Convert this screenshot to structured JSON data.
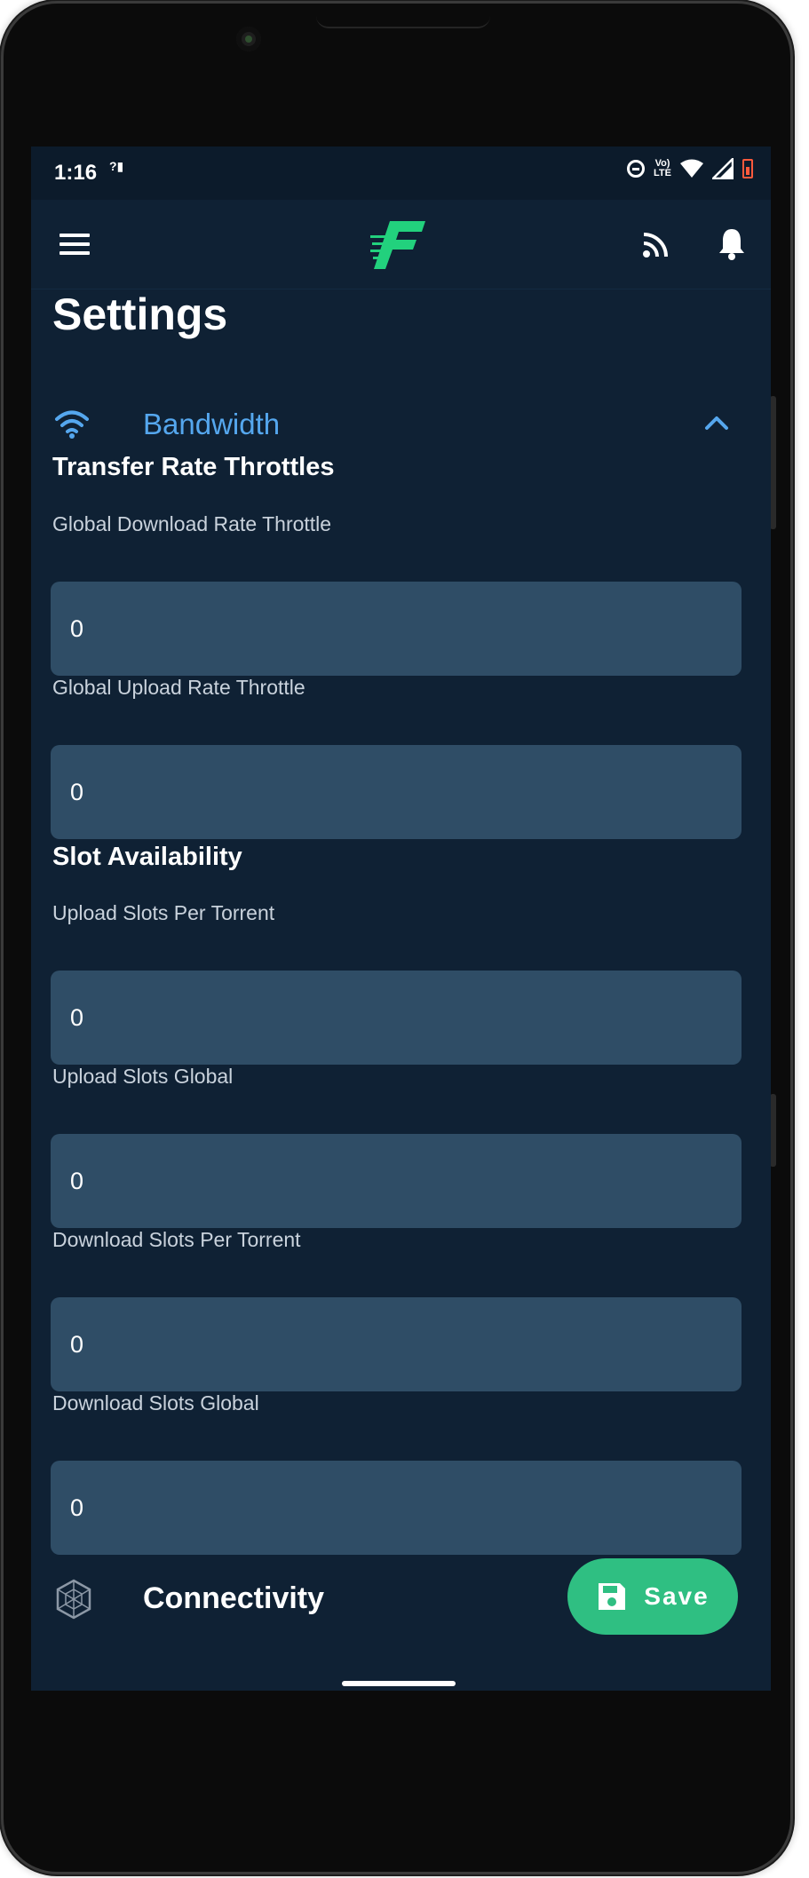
{
  "statusbar": {
    "time": "1:16",
    "network_icon": "no-signal-icon",
    "volte_top": "Vo)",
    "volte_bottom": "LTE",
    "icons": [
      "do-not-disturb-icon",
      "volte-icon",
      "wifi-icon",
      "signal-icon",
      "battery-low-icon"
    ],
    "battery_color": "#ff5a3c"
  },
  "appbar": {
    "menu_icon": "hamburger-menu-icon",
    "logo_icon": "app-logo-f-icon",
    "logo_color": "#22d17d",
    "cast_icon": "rss-feed-icon",
    "notification_icon": "bell-icon"
  },
  "page": {
    "title": "Settings"
  },
  "bandwidth": {
    "icon": "wifi-icon",
    "label": "Bandwidth",
    "expanded": true,
    "accent_color": "#55a7ee",
    "groups": [
      {
        "title": "Transfer Rate Throttles",
        "fields": [
          {
            "label": "Global Download Rate Throttle",
            "value": "0"
          },
          {
            "label": "Global Upload Rate Throttle",
            "value": "0"
          }
        ]
      },
      {
        "title": "Slot Availability",
        "fields": [
          {
            "label": "Upload Slots Per Torrent",
            "value": "0"
          },
          {
            "label": "Upload Slots Global",
            "value": "0"
          },
          {
            "label": "Download Slots Per Torrent",
            "value": "0"
          },
          {
            "label": "Download Slots Global",
            "value": "0"
          }
        ]
      }
    ]
  },
  "connectivity": {
    "icon": "hexagon-network-icon",
    "label": "Connectivity"
  },
  "save_button": {
    "icon": "floppy-disk-icon",
    "label": "Save",
    "color": "#2fbf82"
  },
  "colors": {
    "background": "#0f2134",
    "input_background": "#2f4d66"
  }
}
